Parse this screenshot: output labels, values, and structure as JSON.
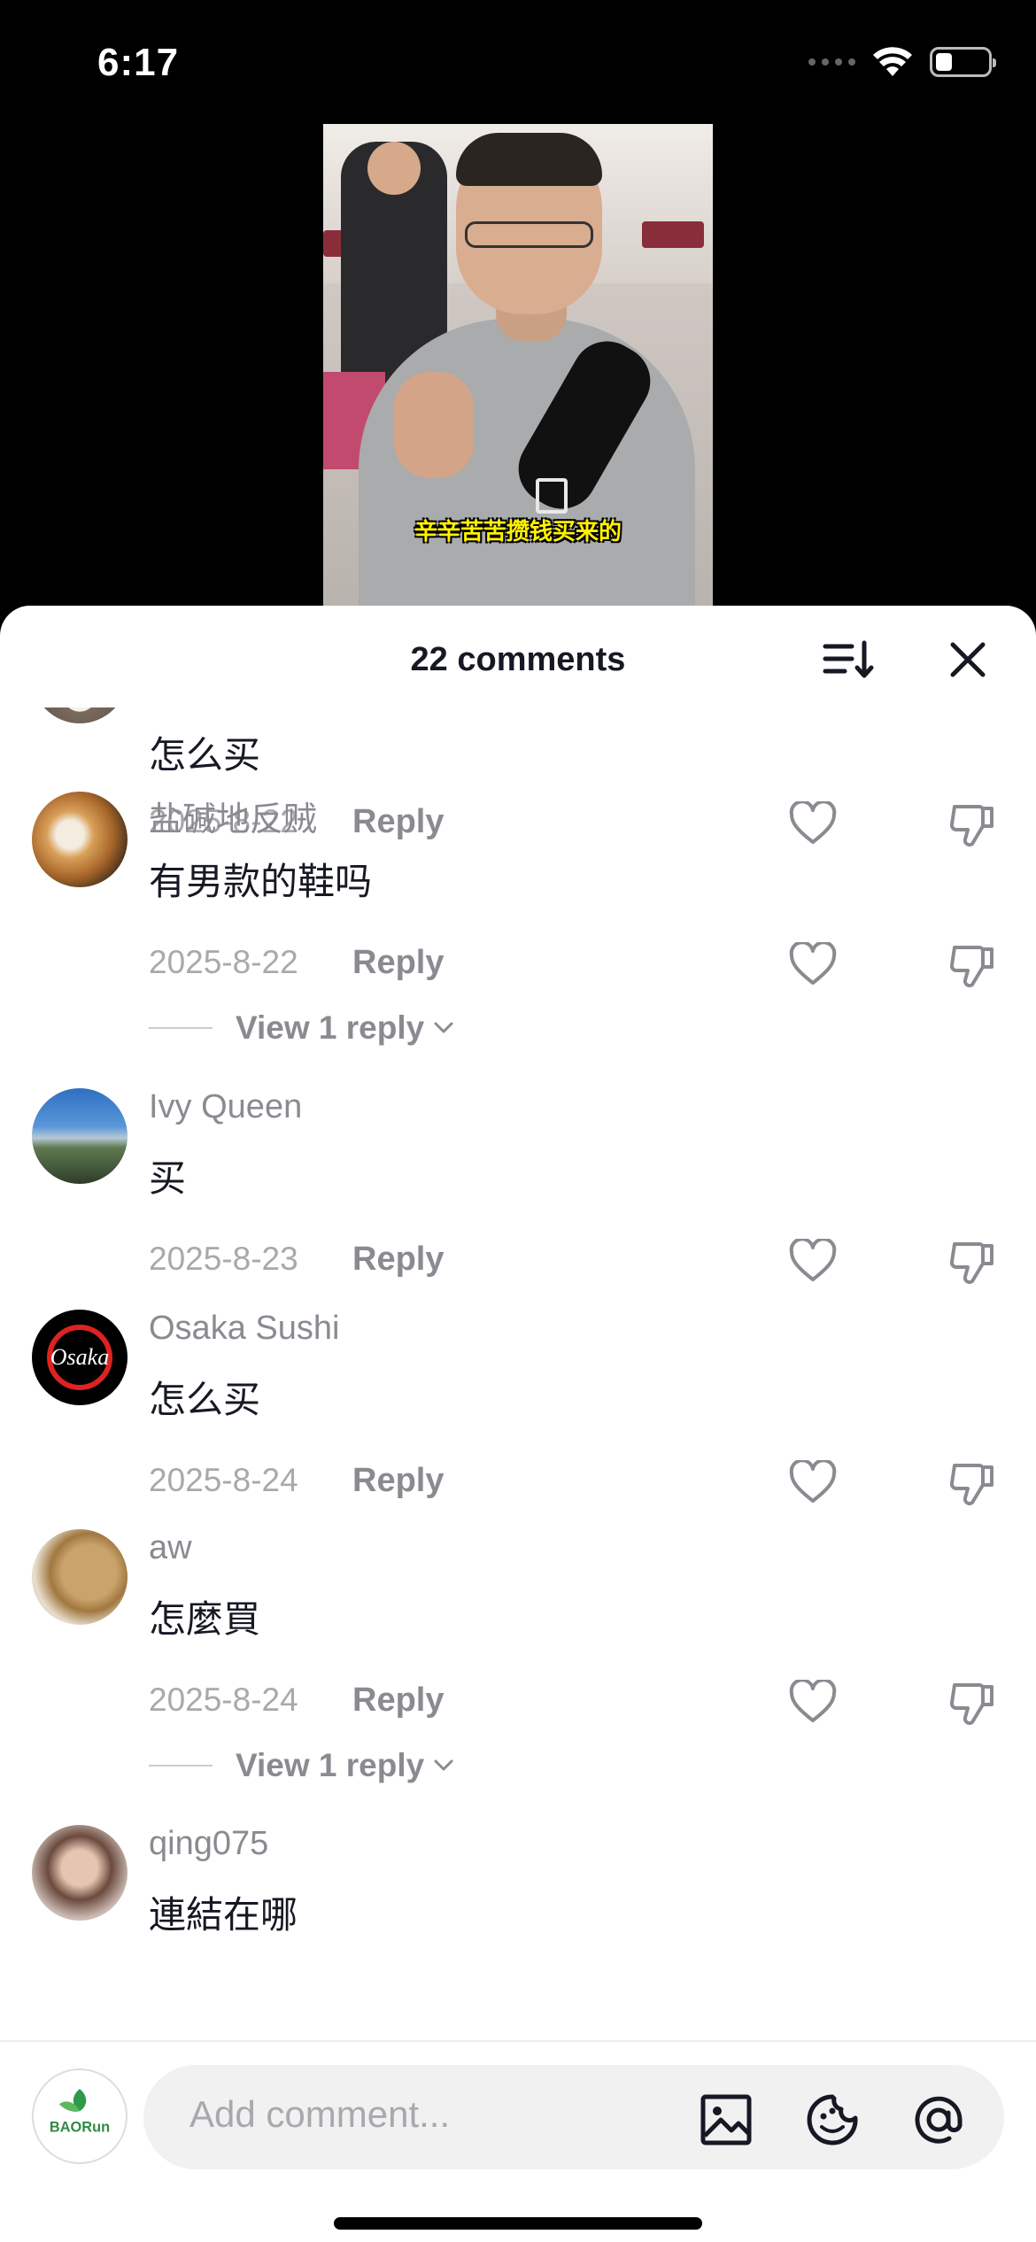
{
  "status_bar": {
    "time": "6:17"
  },
  "video": {
    "subtitle": "辛辛苦苦攒钱买来的"
  },
  "sheet": {
    "title": "22 comments"
  },
  "comments": [
    {
      "username": "",
      "text": "怎么买",
      "date": "2025-8-22",
      "reply_label": "Reply"
    },
    {
      "username": "盐碱地反贼",
      "text": "有男款的鞋吗",
      "date": "2025-8-22",
      "reply_label": "Reply",
      "view_replies": "View 1 reply"
    },
    {
      "username": "Ivy Queen",
      "text": "买",
      "date": "2025-8-23",
      "reply_label": "Reply"
    },
    {
      "username": "Osaka Sushi",
      "text": "怎么买",
      "date": "2025-8-24",
      "reply_label": "Reply"
    },
    {
      "username": "aw",
      "text": "怎麼買",
      "date": "2025-8-24",
      "reply_label": "Reply",
      "view_replies": "View 1 reply"
    },
    {
      "username": "qing075",
      "text": "連結在哪"
    }
  ],
  "avatars": {
    "osaka_logo_text": "Osaka",
    "my_avatar_text": "BAORun"
  },
  "comment_input": {
    "placeholder": "Add comment..."
  }
}
